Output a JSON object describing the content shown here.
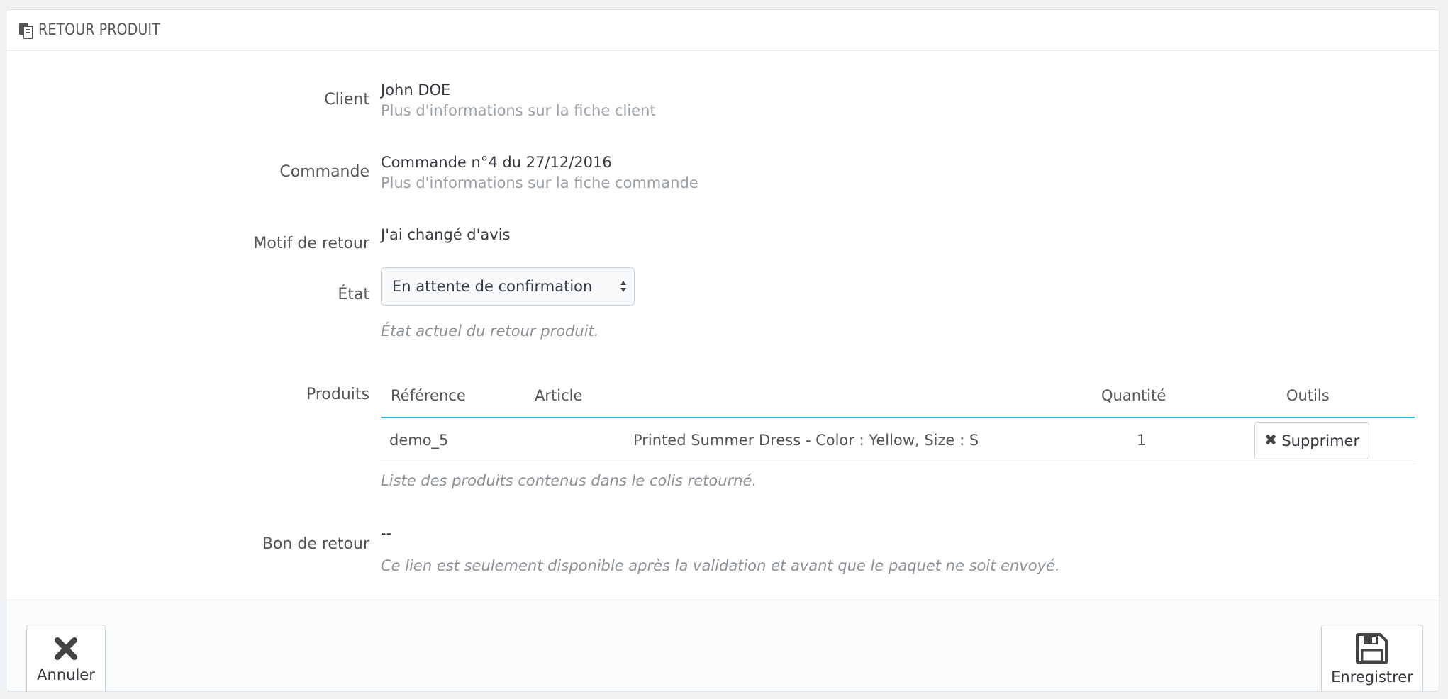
{
  "header": {
    "title": "RETOUR PRODUIT",
    "icon": "return-document-icon"
  },
  "form": {
    "client": {
      "label": "Client",
      "value": "John DOE",
      "link": "Plus d'informations sur la fiche client"
    },
    "commande": {
      "label": "Commande",
      "value": "Commande n°4 du 27/12/2016",
      "link": "Plus d'informations sur la fiche commande"
    },
    "motif": {
      "label": "Motif de retour",
      "value": "J'ai changé d'avis"
    },
    "etat": {
      "label": "État",
      "selected": "En attente de confirmation",
      "help": "État actuel du retour produit."
    },
    "produits": {
      "label": "Produits",
      "columns": [
        "Référence",
        "Article",
        "Quantité",
        "Outils"
      ],
      "rows": [
        {
          "reference": "demo_5",
          "article": "Printed Summer Dress - Color : Yellow, Size : S",
          "quantite": "1",
          "action": "Supprimer"
        }
      ],
      "help": "Liste des produits contenus dans le colis retourné."
    },
    "bon_de_retour": {
      "label": "Bon de retour",
      "value": "--",
      "help": "Ce lien est seulement disponible après la validation et avant que le paquet ne soit envoyé."
    }
  },
  "footer": {
    "cancel_label": "Annuler",
    "save_label": "Enregistrer"
  }
}
